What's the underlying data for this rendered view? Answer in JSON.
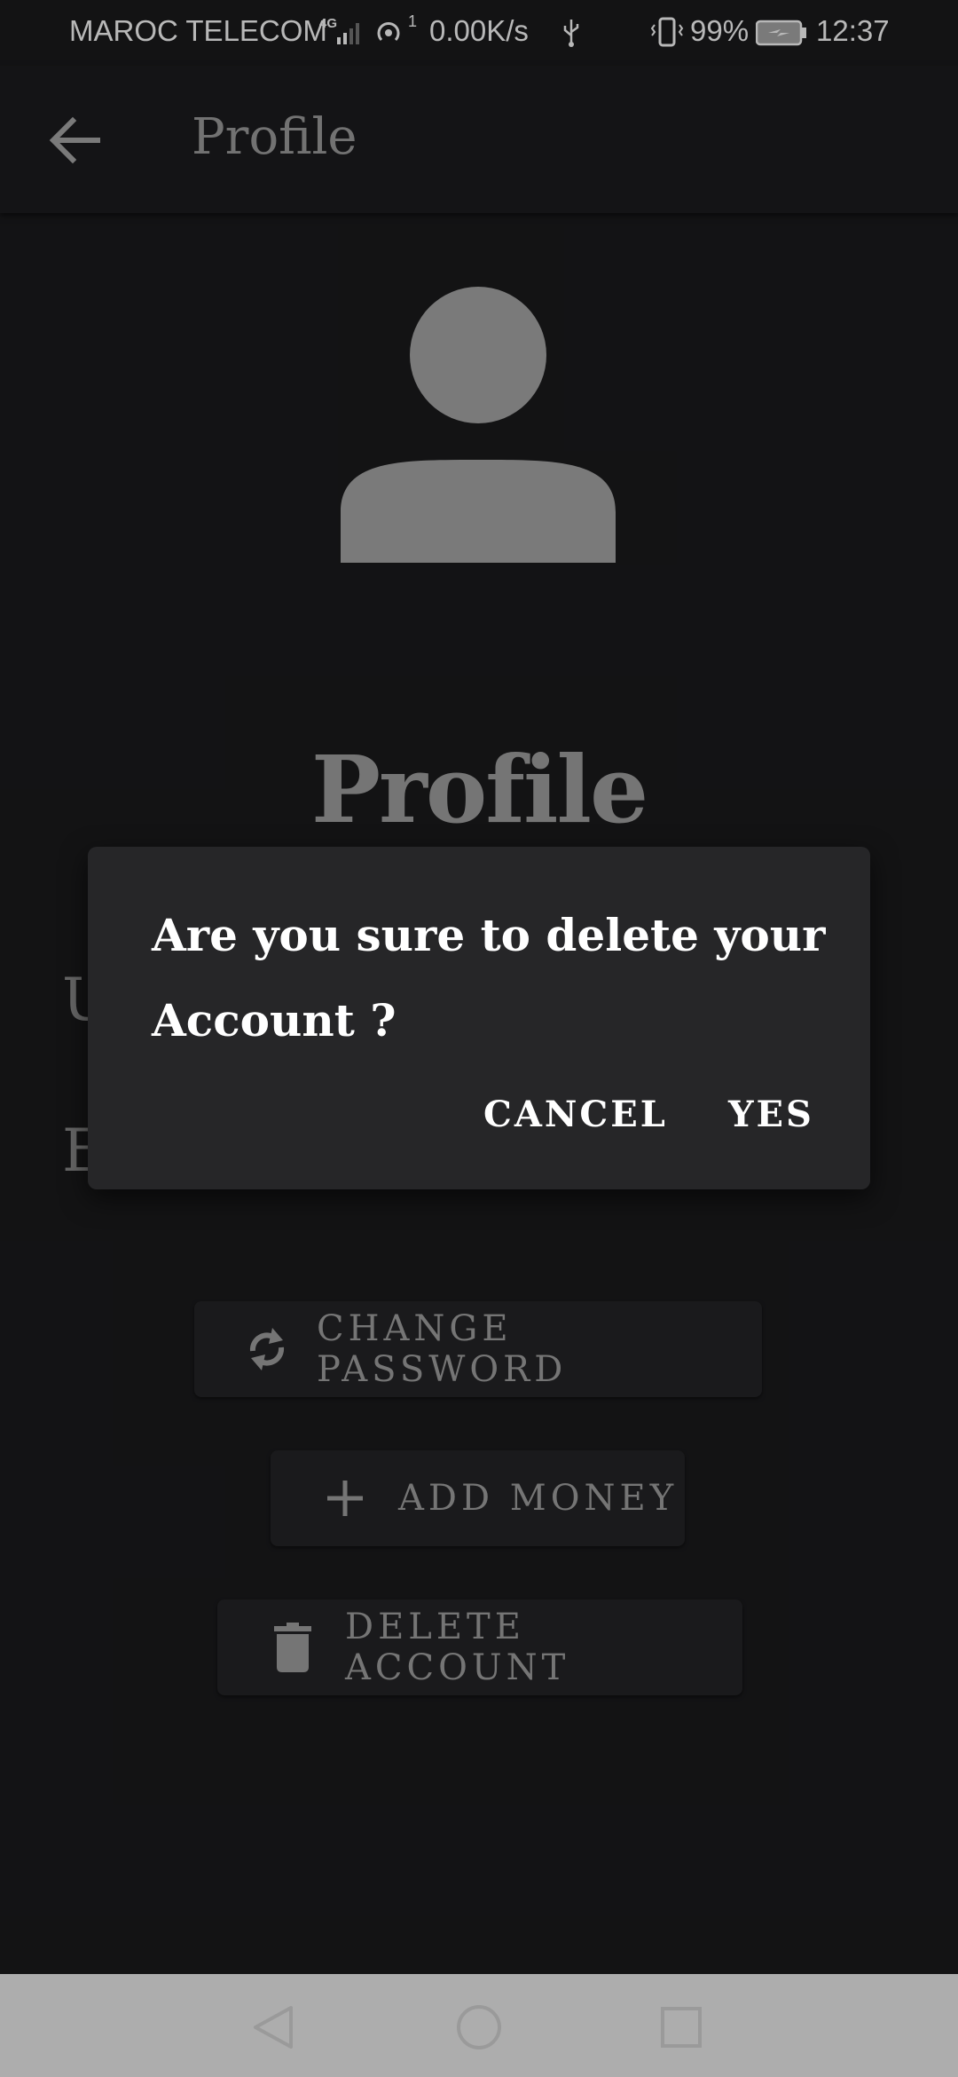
{
  "status_bar": {
    "carrier": "MAROC TELECOM",
    "network_type": "4G",
    "hotspot_badge": "1",
    "speed": "0.00K/s",
    "battery": "99%",
    "time": "12:37",
    "icons": [
      "signal-icon",
      "hotspot-icon",
      "usb-icon",
      "vibrate-icon",
      "battery-charging-icon"
    ]
  },
  "app_bar": {
    "title": "Profile",
    "back_icon": "arrow-left-icon"
  },
  "profile": {
    "avatar_icon": "person-icon",
    "heading": "Profile",
    "field_letters": [
      "U",
      "E"
    ]
  },
  "actions": [
    {
      "label": "CHANGE PASSWORD",
      "icon": "refresh-icon"
    },
    {
      "label": "ADD MONEY",
      "icon": "plus-icon"
    },
    {
      "label": "DELETE ACCOUNT",
      "icon": "trash-icon"
    }
  ],
  "dialog": {
    "message": "Are you sure to delete your Account ?",
    "cancel_label": "CANCEL",
    "confirm_label": "YES"
  },
  "nav_bar": {
    "icons": [
      "back-triangle-icon",
      "home-circle-icon",
      "recents-square-icon"
    ]
  },
  "colors": {
    "background": "#1b1b1d",
    "dialog": "#262628",
    "button": "#252527",
    "text_muted": "#a3a3a3",
    "nav_bar": "#adadad"
  }
}
